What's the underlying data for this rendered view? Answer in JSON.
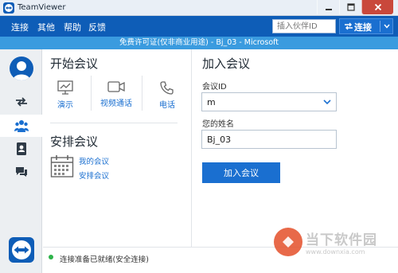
{
  "window": {
    "title": "TeamViewer"
  },
  "menu": {
    "items": [
      "连接",
      "其他",
      "帮助",
      "反馈"
    ]
  },
  "partner": {
    "placeholder": "插入伙伴ID",
    "connect_label": "连接"
  },
  "license_bar": {
    "text": "免费许可证(仅非商业用途) - Bj_03 - Microsoft"
  },
  "start_meeting": {
    "title": "开始会议",
    "features": [
      {
        "label": "演示",
        "icon": "presentation-icon"
      },
      {
        "label": "视频通话",
        "icon": "video-camera-icon"
      },
      {
        "label": "电话",
        "icon": "phone-icon"
      }
    ]
  },
  "schedule_meeting": {
    "title": "安排会议",
    "links": [
      "我的会议",
      "安排会议"
    ],
    "icon": "calendar-icon"
  },
  "join_meeting": {
    "title": "加入会议",
    "meeting_id_label": "会议ID",
    "meeting_id_value": "m",
    "name_label": "您的姓名",
    "name_value": "Bj_03",
    "button_label": "加入会议"
  },
  "status": {
    "text": "连接准备已就绪(安全连接)",
    "color": "#2db34a"
  },
  "watermark": {
    "text": "当下软件园",
    "url": "www.downxia.com"
  },
  "colors": {
    "brand": "#0e5db7",
    "accent": "#1a6fd0",
    "license_bar": "#3a9bdf"
  }
}
